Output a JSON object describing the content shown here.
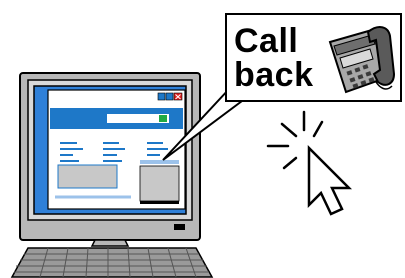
{
  "callout": {
    "line1": "Call",
    "line2": "back"
  },
  "icons": {
    "computer": "desktop-computer-icon",
    "telephone": "desk-phone-icon",
    "cursor": "mouse-pointer-icon",
    "keyboard": "keyboard-icon"
  },
  "colors": {
    "monitor_frame": "#b3b3b3",
    "screen_blue": "#2e7fd9",
    "browser_header": "#1e78c8",
    "close_button": "#e02020",
    "ok_button": "#22aa44",
    "text_lines": "#1e78c8",
    "image_block": "#c8c8c8"
  }
}
